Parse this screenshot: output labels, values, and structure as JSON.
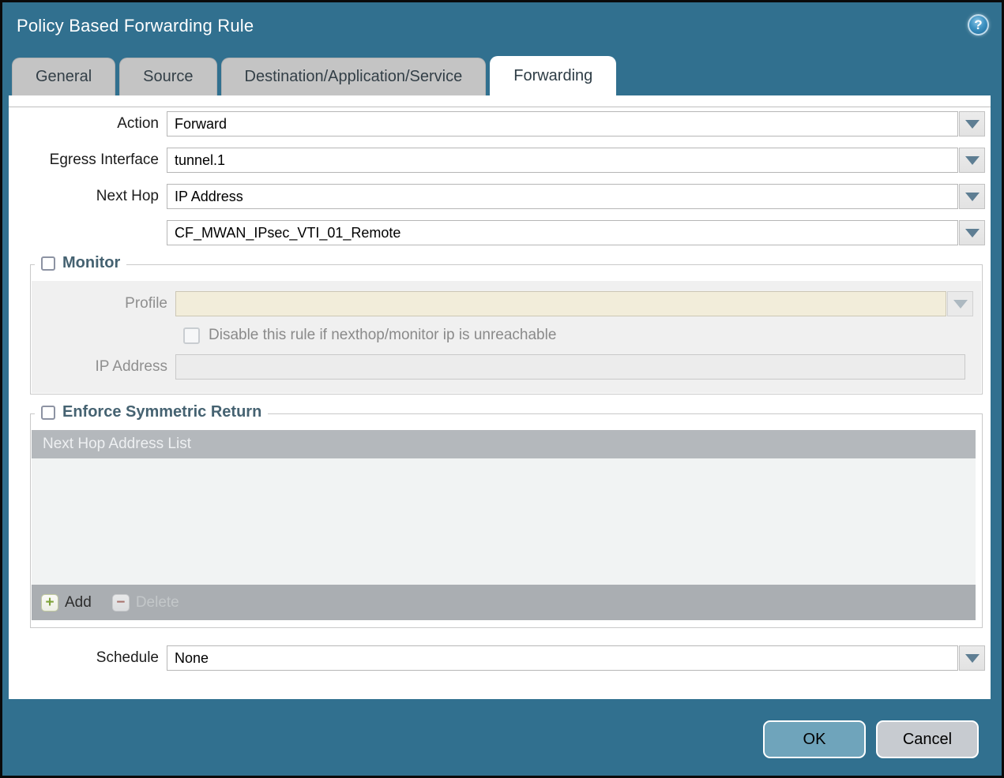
{
  "dialog": {
    "title": "Policy Based Forwarding Rule",
    "help_icon": "question-mark"
  },
  "tabs": [
    {
      "label": "General",
      "active": false
    },
    {
      "label": "Source",
      "active": false
    },
    {
      "label": "Destination/Application/Service",
      "active": false
    },
    {
      "label": "Forwarding",
      "active": true
    }
  ],
  "form": {
    "action": {
      "label": "Action",
      "value": "Forward"
    },
    "egress_interface": {
      "label": "Egress Interface",
      "value": "tunnel.1"
    },
    "next_hop": {
      "label": "Next Hop",
      "value": "IP Address"
    },
    "next_hop_address": {
      "value": "CF_MWAN_IPsec_VTI_01_Remote"
    },
    "schedule": {
      "label": "Schedule",
      "value": "None"
    }
  },
  "monitor": {
    "title": "Monitor",
    "checked": false,
    "profile": {
      "label": "Profile",
      "value": ""
    },
    "disable_rule": {
      "label": "Disable this rule if nexthop/monitor ip is unreachable",
      "checked": false
    },
    "ip_address": {
      "label": "IP Address",
      "value": ""
    }
  },
  "enforce_symmetric_return": {
    "title": "Enforce Symmetric Return",
    "checked": false,
    "table": {
      "header": "Next Hop Address List",
      "rows": []
    },
    "add_label": "Add",
    "delete_label": "Delete",
    "add_icon": "plus",
    "delete_icon": "minus"
  },
  "footer": {
    "ok_label": "OK",
    "cancel_label": "Cancel"
  },
  "colors": {
    "accent_teal": "#31708f",
    "tab_gray": "#c4c4c4",
    "disabled_beige": "#f2edda",
    "table_header_gray": "#b4b8bc",
    "ok_blue": "#6fa4bb"
  }
}
